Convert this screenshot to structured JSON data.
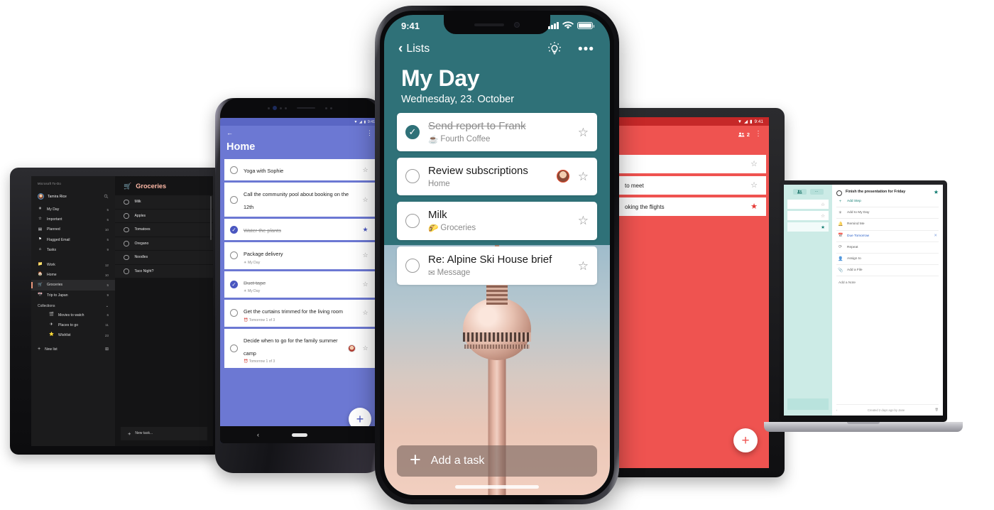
{
  "iphone": {
    "status": {
      "time": "9:41",
      "signal_icon": "cellular-bars-icon",
      "wifi_icon": "wifi-icon",
      "battery_icon": "battery-icon"
    },
    "nav": {
      "back_label": "Lists",
      "back_icon": "chevron-left-icon",
      "suggestions_icon": "lightbulb-icon",
      "more_icon": "ellipsis-icon"
    },
    "title": "My Day",
    "subtitle": "Wednesday, 23. October",
    "tasks": [
      {
        "title": "Send report to Frank",
        "meta": "Fourth Coffee",
        "meta_icon": "☕",
        "done": true,
        "starred": false,
        "avatar": false
      },
      {
        "title": "Review subscriptions",
        "meta": "Home",
        "meta_icon": "",
        "done": false,
        "starred": false,
        "avatar": true
      },
      {
        "title": "Milk",
        "meta": "Groceries",
        "meta_icon": "🌮",
        "done": false,
        "starred": false,
        "avatar": false
      },
      {
        "title": "Re: Alpine Ski House brief",
        "meta": "Message",
        "meta_icon": "✉",
        "done": false,
        "starred": false,
        "avatar": false
      }
    ],
    "add_task": {
      "label": "Add a task",
      "icon": "plus-icon"
    },
    "background_photo": "berlin-tv-tower",
    "accent_color": "#2f7178"
  },
  "android_phone": {
    "status": {
      "time": "9:41",
      "wifi_icon": "wifi-icon",
      "signal_icon": "signal-icon",
      "battery_icon": "battery-icon"
    },
    "nav": {
      "back_icon": "arrow-back-icon",
      "more_icon": "kebab-menu-icon"
    },
    "title": "Home",
    "tasks": [
      {
        "title": "Yoga with Sophie",
        "meta": "",
        "done": false,
        "starred": false,
        "avatar": false
      },
      {
        "title": "Call the community pool about booking on the 12th",
        "meta": "",
        "done": false,
        "starred": false,
        "avatar": false
      },
      {
        "title": "Water the plants",
        "meta": "",
        "done": true,
        "starred": true,
        "avatar": false
      },
      {
        "title": "Package delivery",
        "meta": "☀ My Day",
        "done": false,
        "starred": false,
        "avatar": false
      },
      {
        "title": "Duct tape",
        "meta": "☀ My Day",
        "done": true,
        "starred": false,
        "avatar": false
      },
      {
        "title": "Get the curtains trimmed for the living room",
        "meta": "⏰ Tomorrow  1 of 3",
        "done": false,
        "starred": false,
        "avatar": false
      },
      {
        "title": "Decide when to go for the family summer camp",
        "meta": "⏰ Tomorrow  1 of 3",
        "done": false,
        "starred": false,
        "avatar": true
      }
    ],
    "fab": {
      "icon": "plus-icon"
    },
    "accent_color": "#6c78d3"
  },
  "dark_tablet": {
    "brand": "Microsoft To-Do",
    "user": {
      "name": "Tamira Rice",
      "search_icon": "search-icon",
      "avatar": "user-avatar"
    },
    "smart_lists": [
      {
        "icon": "☀",
        "label": "My Day",
        "count": "5"
      },
      {
        "icon": "☆",
        "label": "Important",
        "count": "5"
      },
      {
        "icon": "▤",
        "label": "Planned",
        "count": "10"
      },
      {
        "icon": "⚑",
        "label": "Flagged Email",
        "count": "5"
      },
      {
        "icon": "⌂",
        "label": "Tasks",
        "count": "9"
      }
    ],
    "lists": [
      {
        "icon": "📁",
        "label": "Work",
        "count": "12",
        "selected": false
      },
      {
        "icon": "🏠",
        "label": "Home",
        "count": "10",
        "selected": false
      },
      {
        "icon": "🛒",
        "label": "Groceries",
        "count": "5",
        "selected": true
      },
      {
        "icon": "🎌",
        "label": "Trip to Japan",
        "count": "9",
        "selected": false
      }
    ],
    "collections": {
      "label": "Collections",
      "chevron_icon": "chevron-down-icon",
      "items": [
        {
          "icon": "🎬",
          "label": "Movies to watch",
          "count": "6"
        },
        {
          "icon": "✈",
          "label": "Places to go",
          "count": "11"
        },
        {
          "icon": "⭐",
          "label": "Wishlist",
          "count": "23"
        }
      ]
    },
    "new_list": {
      "label": "New list",
      "plus_icon": "plus-icon",
      "group_icon": "new-group-icon"
    },
    "list_title": {
      "icon": "🛒",
      "label": "Groceries",
      "color": "#ffb9a7"
    },
    "tasks": [
      "Milk",
      "Apples",
      "Tomatoes",
      "Oregano",
      "Noodles",
      "Taco Night?"
    ],
    "new_task": {
      "label": "New task...",
      "plus_icon": "plus-icon"
    }
  },
  "red_tablet": {
    "status": {
      "time": "9:41",
      "wifi_icon": "wifi-icon",
      "signal_icon": "signal-icon",
      "battery_icon": "battery-icon"
    },
    "toolbar": {
      "share_count": "2",
      "share_icon": "people-icon",
      "more_icon": "kebab-menu-icon"
    },
    "tasks": [
      {
        "title": "",
        "starred": false
      },
      {
        "title": "to meet",
        "starred": false
      },
      {
        "title": "oking the flights",
        "starred": true
      }
    ],
    "fab": {
      "icon": "plus-icon"
    },
    "accent_color": "#ef5350"
  },
  "laptop": {
    "sidebar": {
      "share_icon": "people-icon",
      "more_icon": "ellipsis-icon"
    },
    "detail": {
      "title": "Finish the presentation for Friday",
      "starred": true,
      "items": [
        {
          "icon": "+",
          "label": "Add Step",
          "style": "accent-teal",
          "removable": false
        },
        {
          "icon": "☀",
          "label": "Add to My Day",
          "style": "normal",
          "removable": false
        },
        {
          "icon": "🔔",
          "label": "Remind Me",
          "style": "normal",
          "removable": false
        },
        {
          "icon": "📅",
          "label": "Due Tomorrow",
          "style": "accent-blue",
          "removable": true
        },
        {
          "icon": "⟳",
          "label": "Repeat",
          "style": "normal",
          "removable": false
        },
        {
          "icon": "👤",
          "label": "Assign to",
          "style": "normal",
          "removable": false
        },
        {
          "icon": "📎",
          "label": "Add a File",
          "style": "normal",
          "removable": false
        }
      ],
      "note_placeholder": "Add a Note",
      "footer": {
        "collapse_icon": "chevron-left-icon",
        "created": "Created 2 days ago by Jane",
        "delete_icon": "trash-icon"
      }
    },
    "accent_color": "#0f7b70"
  }
}
